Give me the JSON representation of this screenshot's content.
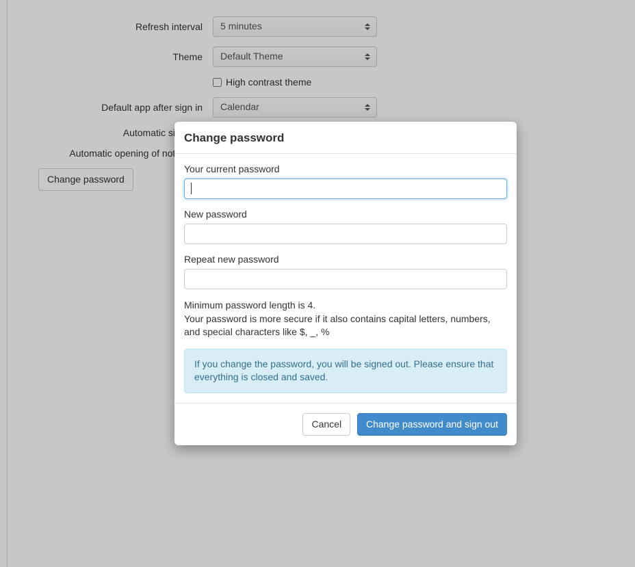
{
  "settings": {
    "refresh_interval_label": "Refresh interval",
    "refresh_interval_value": "5 minutes",
    "theme_label": "Theme",
    "theme_value": "Default Theme",
    "high_contrast_label": "High contrast theme",
    "default_app_label": "Default app after sign in",
    "default_app_value": "Calendar",
    "auto_signout_label": "Automatic si",
    "auto_open_notif_label": "Automatic opening of notificatio",
    "change_password_button": "Change password"
  },
  "modal": {
    "title": "Change password",
    "current_label": "Your current password",
    "new_label": "New password",
    "repeat_label": "Repeat new password",
    "hint_line1": "Minimum password length is 4.",
    "hint_line2": "Your password is more secure if it also contains capital letters, numbers, and special characters like $, _, %",
    "info_text": "If you change the password, you will be signed out. Please ensure that everything is closed and saved.",
    "cancel_label": "Cancel",
    "submit_label": "Change password and sign out"
  }
}
